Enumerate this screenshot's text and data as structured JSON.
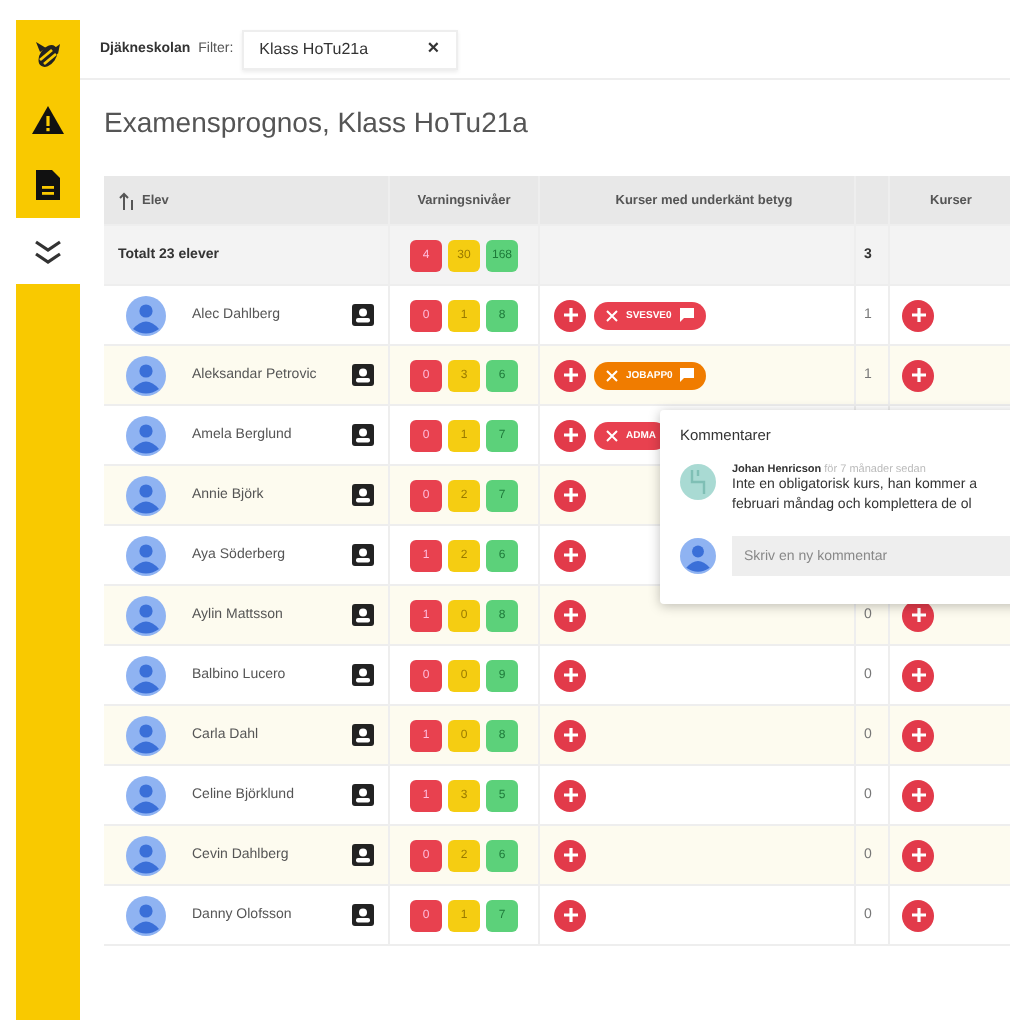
{
  "sidebar": {
    "items": [
      {
        "kind": "logo",
        "selected": false
      },
      {
        "kind": "warning",
        "selected": false
      },
      {
        "kind": "document",
        "selected": false
      },
      {
        "kind": "chevrons",
        "selected": true
      }
    ]
  },
  "topbar": {
    "school": "Djäkneskolan",
    "filter_label": "Filter:",
    "filter_value": "Klass HoTu21a",
    "clear": "×"
  },
  "title": "Examensprognos, Klass HoTu21a",
  "table": {
    "columns": [
      "Elev",
      "Varningsnivåer",
      "Kurser med underkänt betyg",
      "",
      "Kurser"
    ],
    "total": {
      "label": "Totalt 23 elever",
      "levels": [
        "4",
        "30",
        "168"
      ],
      "count": "3"
    },
    "rows": [
      {
        "name": "Alec Dahlberg",
        "levels": [
          "0",
          "1",
          "8"
        ],
        "chips": [
          {
            "code": "SVESVE0",
            "color": "#e8414f",
            "comment_icon": true
          }
        ],
        "count": "1"
      },
      {
        "name": "Aleksandar Petrovic",
        "levels": [
          "0",
          "3",
          "6"
        ],
        "chips": [
          {
            "code": "JOBAPP0",
            "color": "#f07c00",
            "comment_icon": true
          }
        ],
        "count": "1"
      },
      {
        "name": "Amela Berglund",
        "levels": [
          "0",
          "1",
          "7"
        ],
        "chips": [
          {
            "code": "ADMA",
            "color": "#e8414f",
            "comment_icon": false
          }
        ]
      },
      {
        "name": "Annie Björk",
        "levels": [
          "0",
          "2",
          "7"
        ],
        "chips": []
      },
      {
        "name": "Aya Söderberg",
        "levels": [
          "1",
          "2",
          "6"
        ],
        "chips": []
      },
      {
        "name": "Aylin Mattsson",
        "levels": [
          "1",
          "0",
          "8"
        ],
        "chips": [],
        "count": "0"
      },
      {
        "name": "Balbino Lucero",
        "levels": [
          "0",
          "0",
          "9"
        ],
        "chips": [],
        "count": "0"
      },
      {
        "name": "Carla Dahl",
        "levels": [
          "1",
          "0",
          "8"
        ],
        "chips": [],
        "count": "0"
      },
      {
        "name": "Celine Björklund",
        "levels": [
          "1",
          "3",
          "5"
        ],
        "chips": [],
        "count": "0"
      },
      {
        "name": "Cevin Dahlberg",
        "levels": [
          "0",
          "2",
          "6"
        ],
        "chips": [],
        "count": "0"
      },
      {
        "name": "Danny Olofsson",
        "levels": [
          "0",
          "1",
          "7"
        ],
        "chips": [],
        "count": "0"
      }
    ]
  },
  "comments": {
    "title": "Kommentarer",
    "items": [
      {
        "author": "Johan Henricson",
        "time": "för 7 månader sedan",
        "lines": [
          "Inte en obligatorisk kurs, han kommer a",
          "februari måndag och komplettera de ol"
        ]
      }
    ],
    "placeholder": "Skriv en ny kommentar"
  }
}
